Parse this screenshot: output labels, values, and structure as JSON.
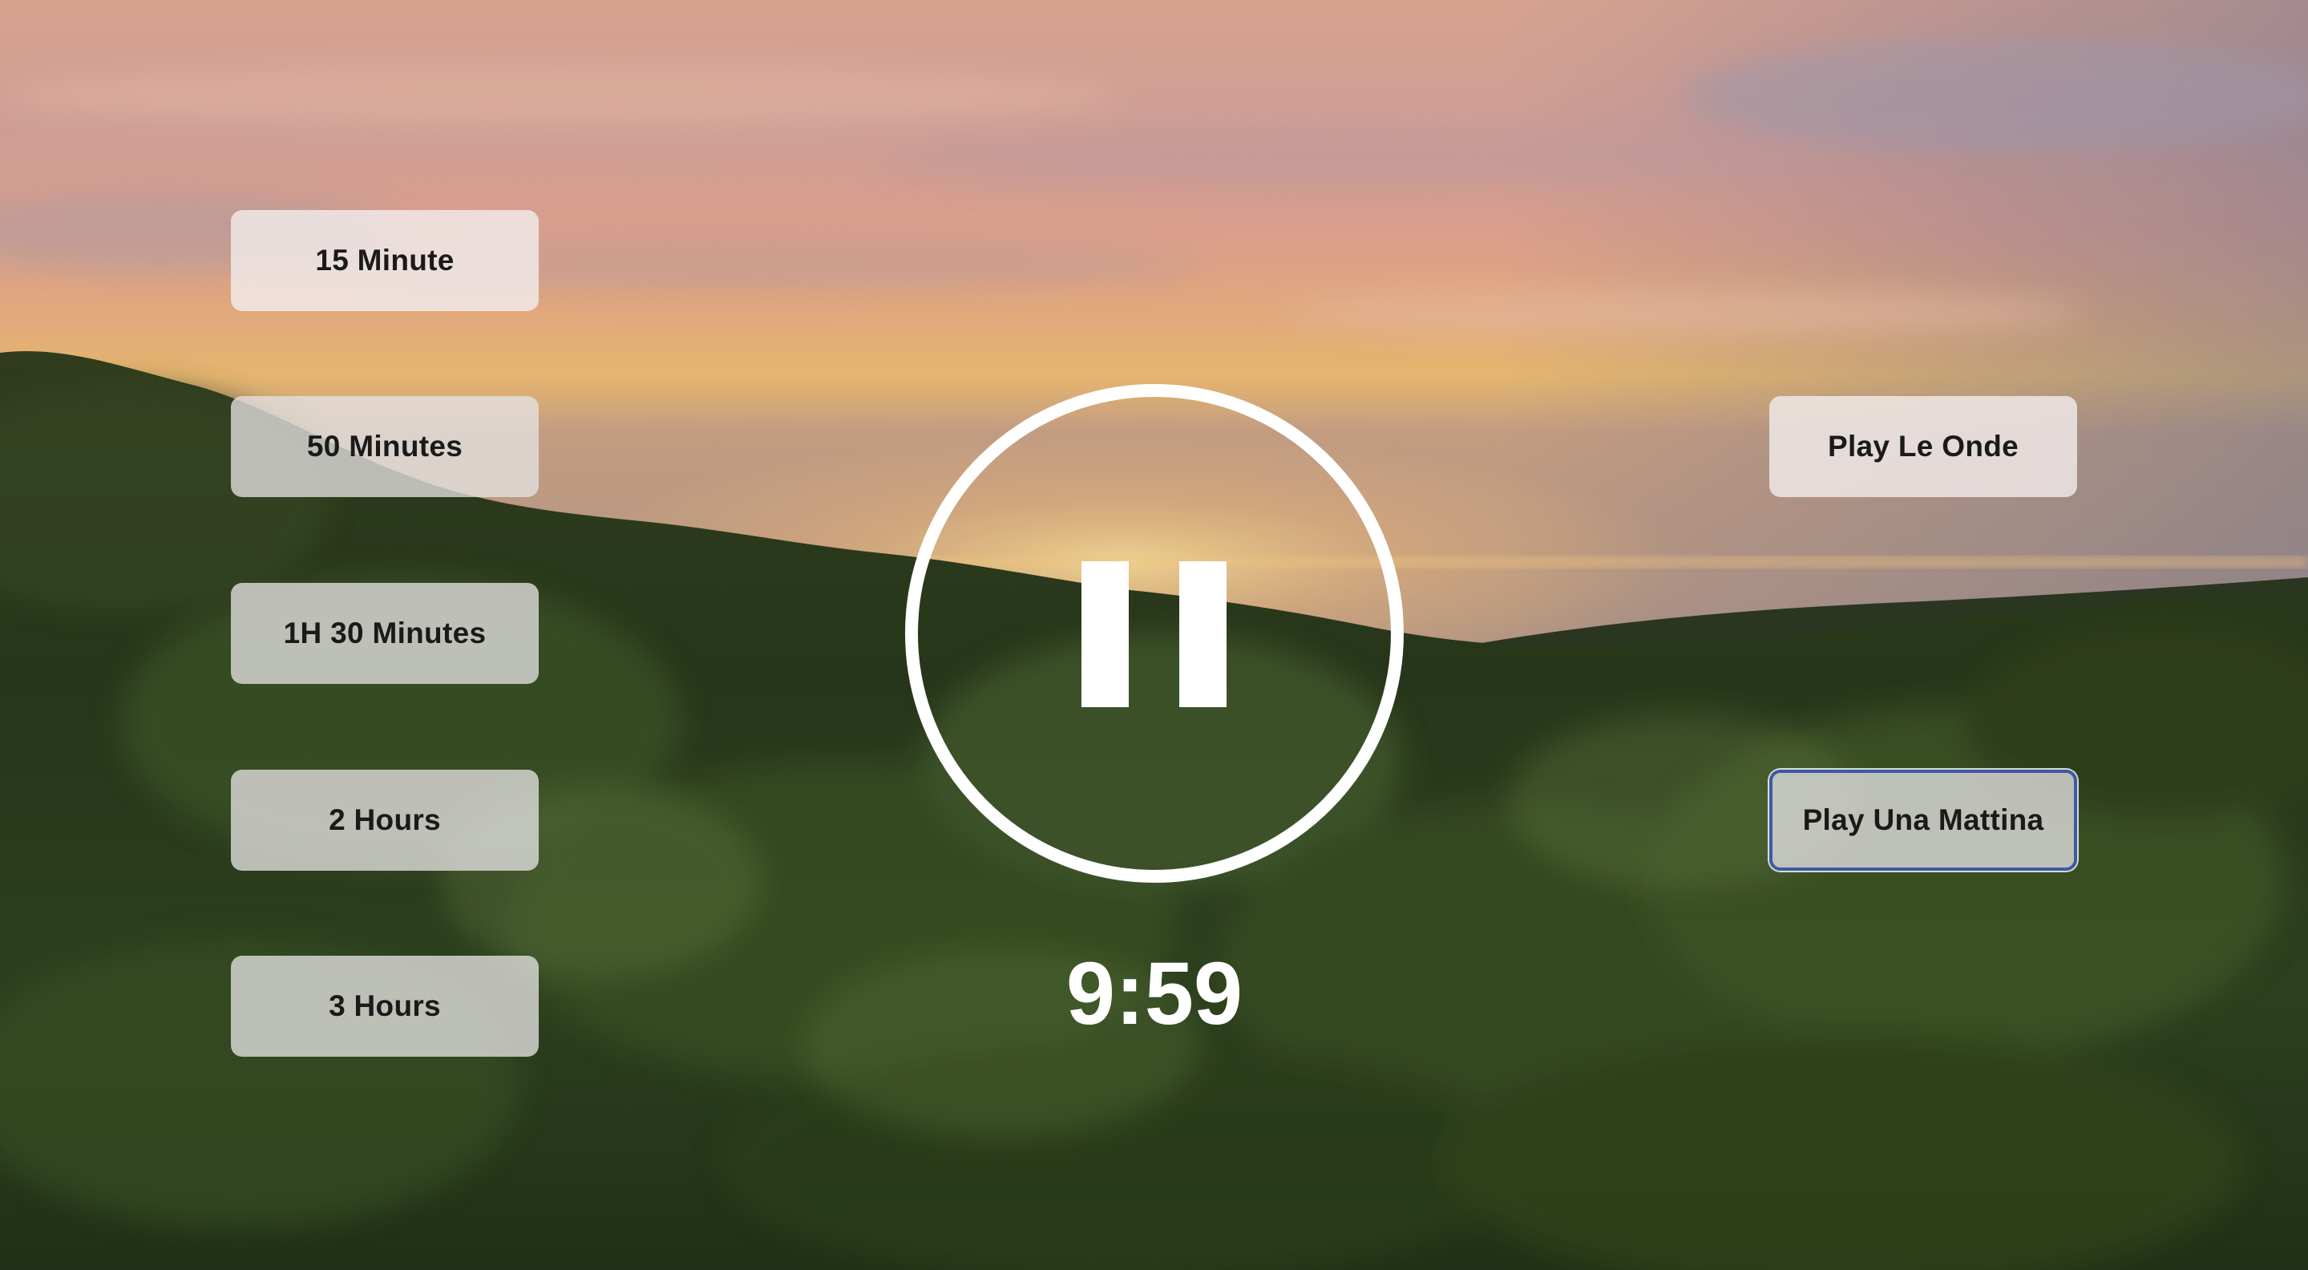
{
  "timer_buttons": [
    {
      "label": "15 Minute"
    },
    {
      "label": "50 Minutes"
    },
    {
      "label": "1H 30 Minutes"
    },
    {
      "label": "2 Hours"
    },
    {
      "label": "3 Hours"
    }
  ],
  "track_buttons": [
    {
      "label": "Play Le Onde"
    },
    {
      "label": "Play Una Mattina"
    }
  ],
  "player": {
    "state_icon": "pause-icon",
    "time_remaining": "9:59"
  },
  "colors": {
    "button_bg": "#f2eeee",
    "button_text": "#1a1a1a",
    "focus_ring": "#3b5aa8",
    "control_white": "#ffffff"
  }
}
